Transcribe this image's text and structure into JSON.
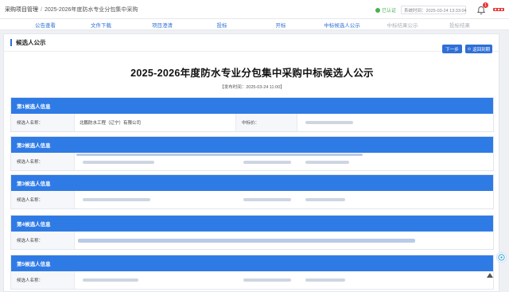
{
  "breadcrumb": {
    "root": "采购项目管理",
    "separator": "/",
    "current": "2025-2026年度防水专业分包集中采购"
  },
  "header": {
    "cert_label": "已认证",
    "server_time": "系统时间：2025-03-24 13:33:04",
    "notification_count": "1"
  },
  "steps": [
    {
      "label": "公告查看",
      "active": true
    },
    {
      "label": "文件下载",
      "active": true
    },
    {
      "label": "项目澄清",
      "active": true
    },
    {
      "label": "投标",
      "active": true
    },
    {
      "label": "开标",
      "active": true
    },
    {
      "label": "中标候选人公示",
      "active": true
    },
    {
      "label": "中标结果公示",
      "active": false
    },
    {
      "label": "投标结果",
      "active": false
    }
  ],
  "panel": {
    "title": "候选人公示",
    "next_button": "下一步",
    "back_button": "返回到期"
  },
  "document": {
    "title": "2025-2026年度防水专业分包集中采购中标候选人公示",
    "publish_time": "【发布时间：2025-03-24 11:00】"
  },
  "candidates": [
    {
      "header": "第1候选人信息",
      "name_label": "候选人名称：",
      "name_value": "北鹏防水工程（辽宁）有限公司",
      "price_label": "中标价："
    },
    {
      "header": "第2候选人信息",
      "name_label": "候选人名称："
    },
    {
      "header": "第3候选人信息",
      "name_label": "候选人名称："
    },
    {
      "header": "第4候选人信息",
      "name_label": "候选人名称："
    },
    {
      "header": "第5候选人信息",
      "name_label": "候选人名称："
    }
  ],
  "colors": {
    "primary": "#2f7be5",
    "accent": "#2f6fd6",
    "badge": "#e53935",
    "cert": "#4caf50"
  }
}
